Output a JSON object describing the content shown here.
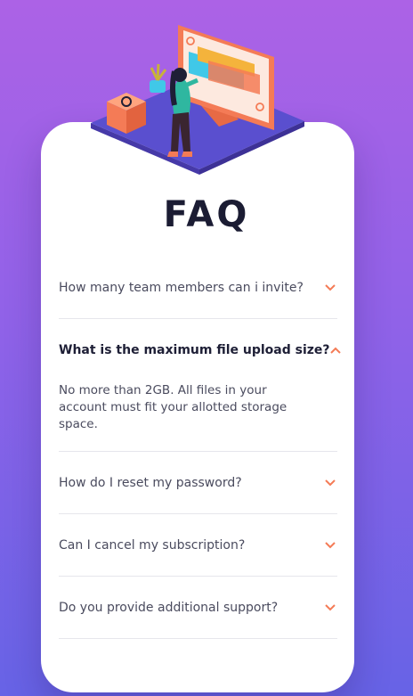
{
  "title": "FAQ",
  "faqs": [
    {
      "question": "How many team members can i invite?",
      "answer": "",
      "open": false,
      "icon": "chevron-down-icon"
    },
    {
      "question": "What is the maximum file upload size?",
      "answer": "No more than 2GB. All files in your account must fit your allotted storage space.",
      "open": true,
      "icon": "chevron-up-icon"
    },
    {
      "question": "How do I reset my password?",
      "answer": "",
      "open": false,
      "icon": "chevron-down-icon"
    },
    {
      "question": "Can I cancel my subscription?",
      "answer": "",
      "open": false,
      "icon": "chevron-down-icon"
    },
    {
      "question": "Do you provide additional support?",
      "answer": "",
      "open": false,
      "icon": "chevron-down-icon"
    }
  ],
  "colors": {
    "accent": "#f47b56",
    "heading": "#1e1f36",
    "text": "#4a4b5e",
    "divider": "#e6e6ec",
    "bg_top": "#ac62e6",
    "bg_bottom": "#6763e6"
  }
}
